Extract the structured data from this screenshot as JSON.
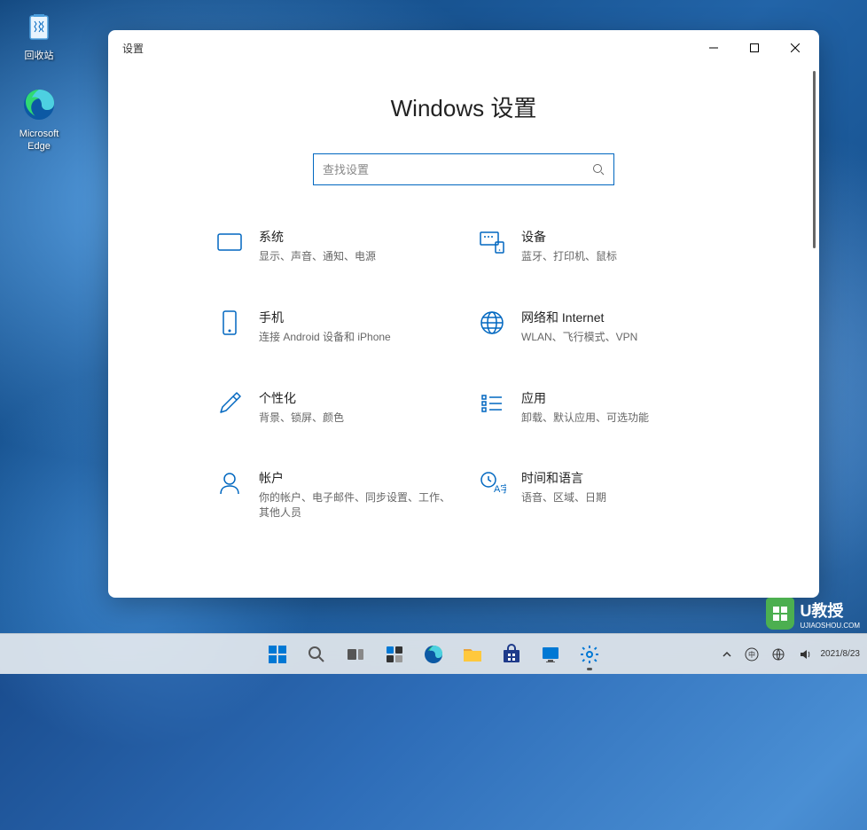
{
  "desktop": {
    "recycle_bin": "回收站",
    "edge": "Microsoft Edge"
  },
  "window": {
    "title": "设置",
    "main_title": "Windows 设置",
    "search_placeholder": "查找设置"
  },
  "categories": [
    {
      "id": "system",
      "title": "系统",
      "desc": "显示、声音、通知、电源"
    },
    {
      "id": "devices",
      "title": "设备",
      "desc": "蓝牙、打印机、鼠标"
    },
    {
      "id": "phone",
      "title": "手机",
      "desc": "连接 Android 设备和 iPhone"
    },
    {
      "id": "network",
      "title": "网络和 Internet",
      "desc": "WLAN、飞行模式、VPN"
    },
    {
      "id": "personalization",
      "title": "个性化",
      "desc": "背景、锁屏、颜色"
    },
    {
      "id": "apps",
      "title": "应用",
      "desc": "卸载、默认应用、可选功能"
    },
    {
      "id": "accounts",
      "title": "帐户",
      "desc": "你的帐户、电子邮件、同步设置、工作、其他人员"
    },
    {
      "id": "time",
      "title": "时间和语言",
      "desc": "语音、区域、日期"
    }
  ],
  "watermark": {
    "text": "U教授",
    "subtext": "UJIAOSHOU.COM"
  },
  "tray": {
    "date": "2021/8/23"
  }
}
